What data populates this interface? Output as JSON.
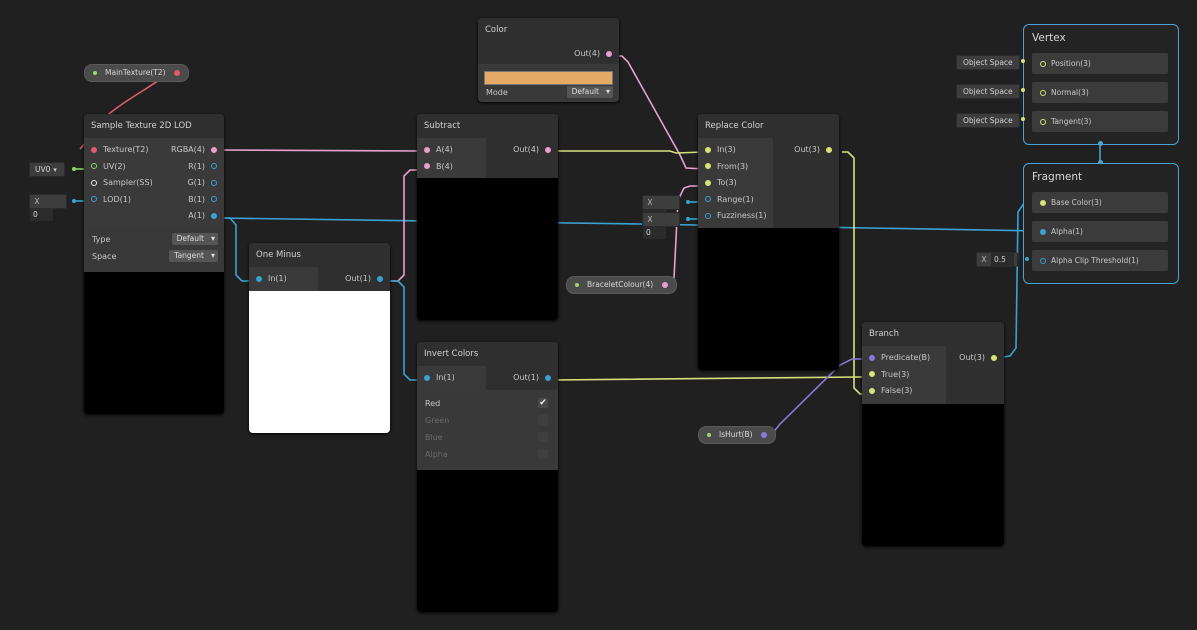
{
  "colors": {
    "pink": "#e7a0d0",
    "red": "#e05a6a",
    "green": "#8fd46a",
    "yellow": "#d8e27a",
    "cyan": "#3aa2d3",
    "purple": "#8a78d8",
    "white": "#e8e8e8"
  },
  "properties": {
    "main_texture": "MainTexture(T2)",
    "bracelet_colour": "BraceletColour(4)",
    "is_hurt": "IsHurt(B)"
  },
  "inline_fields": {
    "uv_value": "UV0",
    "lod_x": "X",
    "lod_value": "0",
    "range_x": "X",
    "range_value": "0",
    "fuzz_x": "X",
    "fuzz_value": "0",
    "alpha_clip_x": "X",
    "alpha_clip_value": "0.5"
  },
  "sample_texture": {
    "title": "Sample Texture 2D LOD",
    "inputs": [
      "Texture(T2)",
      "UV(2)",
      "Sampler(SS)",
      "LOD(1)"
    ],
    "outputs": [
      "RGBA(4)",
      "R(1)",
      "G(1)",
      "B(1)",
      "A(1)"
    ],
    "type_label": "Type",
    "type_value": "Default",
    "space_label": "Space",
    "space_value": "Tangent"
  },
  "one_minus": {
    "title": "One Minus",
    "input": "In(1)",
    "output": "Out(1)"
  },
  "color_node": {
    "title": "Color",
    "output": "Out(4)",
    "mode_label": "Mode",
    "mode_value": "Default",
    "swatch": "#e4aa66"
  },
  "subtract": {
    "title": "Subtract",
    "inputs": [
      "A(4)",
      "B(4)"
    ],
    "output": "Out(4)"
  },
  "invert_colors": {
    "title": "Invert Colors",
    "input": "In(1)",
    "output": "Out(1)",
    "channels": [
      {
        "label": "Red",
        "checked": "✔"
      },
      {
        "label": "Green",
        "checked": ""
      },
      {
        "label": "Blue",
        "checked": ""
      },
      {
        "label": "Alpha",
        "checked": ""
      }
    ]
  },
  "replace_color": {
    "title": "Replace Color",
    "inputs": [
      "In(3)",
      "From(3)",
      "To(3)",
      "Range(1)",
      "Fuzziness(1)"
    ],
    "output": "Out(3)"
  },
  "branch": {
    "title": "Branch",
    "inputs": [
      "Predicate(B)",
      "True(3)",
      "False(3)"
    ],
    "output": "Out(3)"
  },
  "vertex": {
    "title": "Vertex",
    "slots": [
      "Position(3)",
      "Normal(3)",
      "Tangent(3)"
    ],
    "space": "Object Space"
  },
  "fragment": {
    "title": "Fragment",
    "slots": [
      "Base Color(3)",
      "Alpha(1)",
      "Alpha Clip Threshold(1)"
    ]
  }
}
